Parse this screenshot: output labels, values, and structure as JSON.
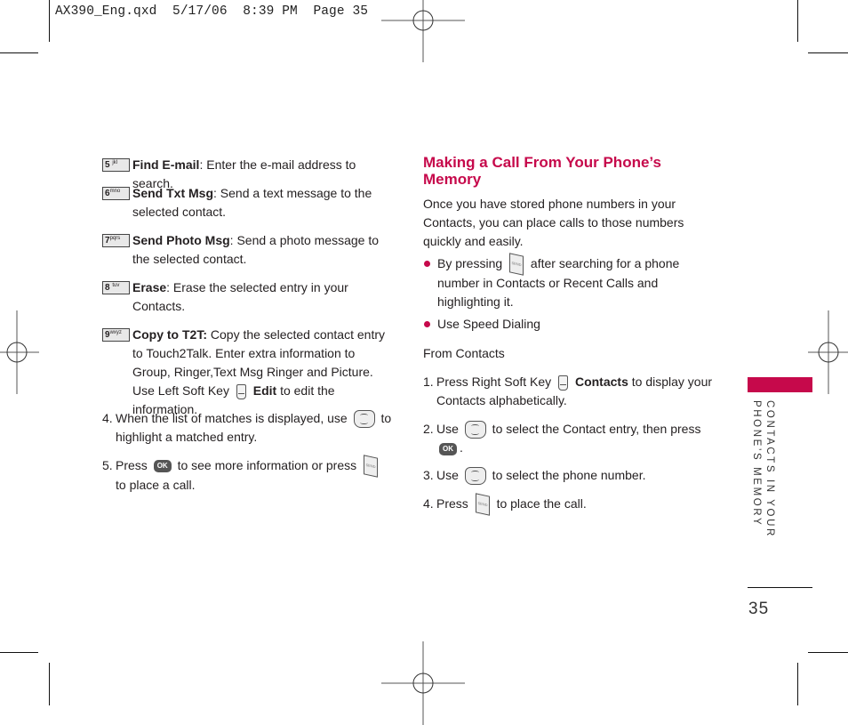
{
  "slug": {
    "text": "AX390_Eng.qxd  5/17/06  8:39 PM  Page 35"
  },
  "left_column": {
    "options": [
      {
        "key_number": "5",
        "key_letters": "jkl",
        "icon": "key-5-icon",
        "title": "Find E-mail",
        "separator": ":",
        "text": " Enter the e-mail address to search."
      },
      {
        "key_number": "6",
        "key_letters": "mno",
        "icon": "key-6-icon",
        "title": "Send Txt Msg",
        "separator": ":",
        "text": " Send a text message to the selected contact."
      },
      {
        "key_number": "7",
        "key_letters": "pqrs",
        "icon": "key-7-icon",
        "title": "Send Photo Msg",
        "separator": ":",
        "text": " Send a photo message to the selected contact."
      },
      {
        "key_number": "8",
        "key_letters": "tuv",
        "icon": "key-8-icon",
        "title": "Erase",
        "separator": ":",
        "text": " Erase the selected entry in your Contacts."
      },
      {
        "key_number": "9",
        "key_letters": "wxyz",
        "icon": "key-9-icon",
        "title": "Copy to T2T:",
        "separator": "",
        "text_before": " Copy the selected contact entry to Touch2Talk. Enter extra information to Group, Ringer,Text Msg Ringer and Picture. Use Left Soft Key ",
        "edit_label": "Edit",
        "text_after": " to edit the information."
      }
    ],
    "steps": [
      {
        "number": "4.",
        "text_before": "When the list of matches is displayed, use ",
        "icon": "nav-key-icon",
        "text_after": " to highlight a matched entry."
      },
      {
        "number": "5.",
        "text_before": "Press ",
        "icon": "ok-key-icon",
        "icon_label": "OK",
        "text_middle": " to see more information or press ",
        "icon2": "send-key-icon",
        "icon2_label": "SEND",
        "text_after": " to place a call."
      }
    ]
  },
  "right_column": {
    "heading": "Making a Call From Your Phone’s Memory",
    "intro": "Once you have stored phone numbers in your Contacts, you can place calls to those numbers quickly and easily.",
    "bullets": [
      {
        "text_before": "By pressing ",
        "icon": "send-key-icon",
        "icon_label": "SEND",
        "text_after": " after searching for a phone number in Contacts or Recent Calls and highlighting it."
      },
      {
        "text": "Use Speed Dialing"
      }
    ],
    "subheading": "From Contacts",
    "steps": [
      {
        "number": "1.",
        "text_before": "Press Right Soft Key ",
        "icon": "right-soft-key-icon",
        "bold": "Contacts",
        "text_after": " to display your Contacts alphabetically."
      },
      {
        "number": "2.",
        "text_before": "Use ",
        "icon": "nav-key-icon",
        "text_middle": " to select the Contact entry, then press ",
        "icon2": "ok-key-icon",
        "icon2_label": "OK",
        "text_after": "."
      },
      {
        "number": "3.",
        "text_before": "Use ",
        "icon": "nav-key-icon",
        "text_after": " to select the phone number."
      },
      {
        "number": "4.",
        "text_before": "Press ",
        "icon": "send-key-icon",
        "icon_label": "SEND",
        "text_after": " to place the call."
      }
    ]
  },
  "sidebar": {
    "section_label": "CONTACTS IN YOUR\nPHONE’S MEMORY",
    "accent_color": "#c6094b"
  },
  "page_number": "35"
}
